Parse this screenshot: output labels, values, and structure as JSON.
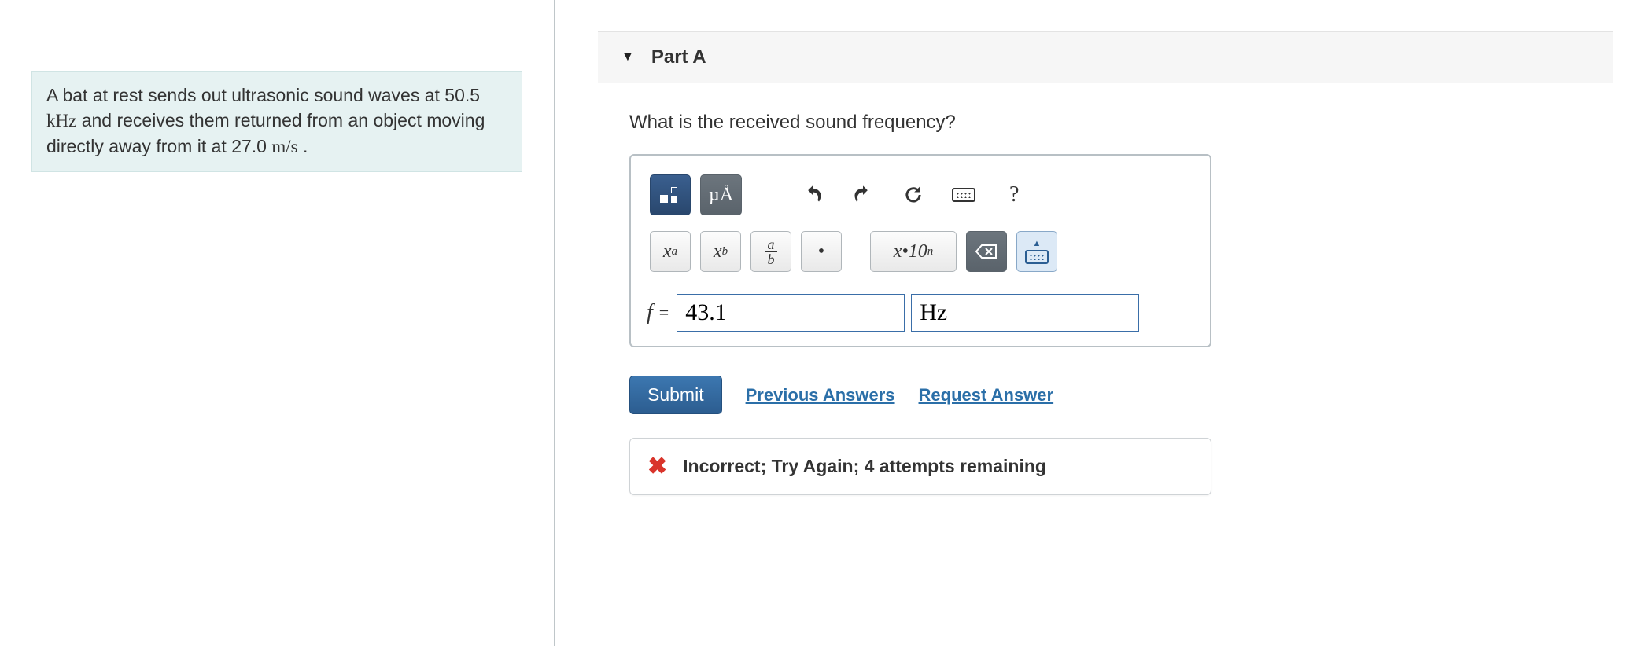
{
  "problem": {
    "text_1": "A bat at rest sends out ultrasonic sound waves at ",
    "freq": "50.5 ",
    "freq_unit": "kHz",
    "text_2": " and receives them returned from an object moving directly away from it at ",
    "speed": "27.0 ",
    "speed_unit": "m/s",
    "text_3": " ."
  },
  "part": {
    "label": "Part A",
    "prompt": "What is the received sound frequency?"
  },
  "toolbar": {
    "units_btn": "µÅ",
    "superscript": "x",
    "superscript_exp": "a",
    "subscript": "x",
    "subscript_sub": "b",
    "frac_n": "a",
    "frac_d": "b",
    "dot": "•",
    "sci": "x•10",
    "sci_exp": "n",
    "help": "?"
  },
  "answer": {
    "var": "f",
    "eq": "=",
    "value": "43.1",
    "unit": "Hz"
  },
  "actions": {
    "submit": "Submit",
    "previous": "Previous Answers",
    "request": "Request Answer"
  },
  "feedback": {
    "icon": "✖",
    "message": "Incorrect; Try Again; 4 attempts remaining"
  }
}
